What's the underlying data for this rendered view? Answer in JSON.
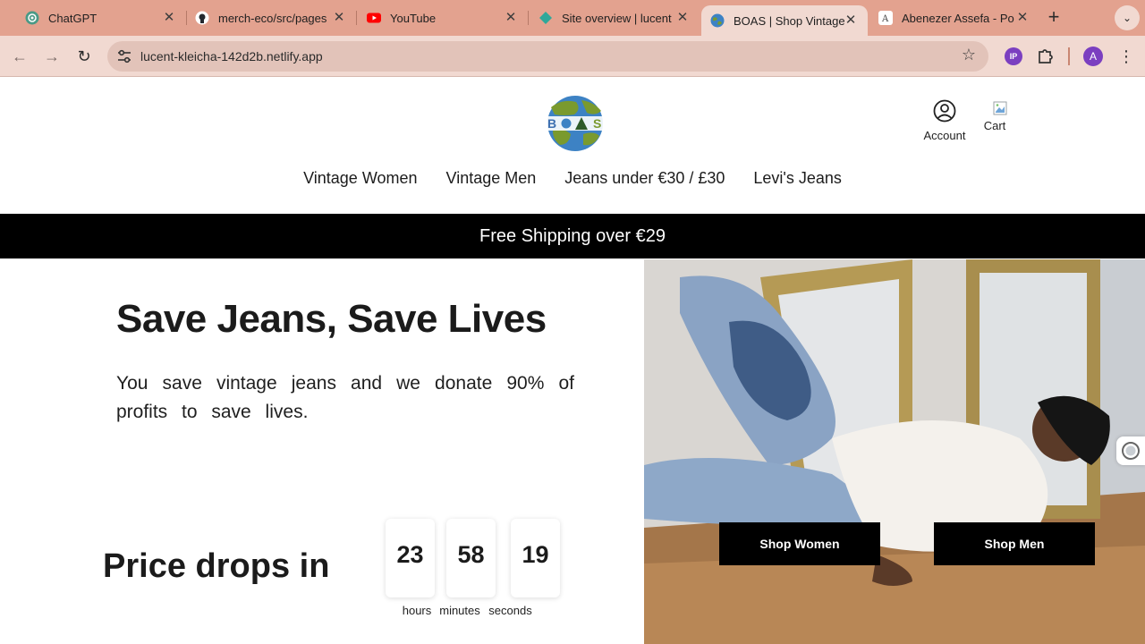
{
  "browser": {
    "tabs": [
      {
        "title": "ChatGPT",
        "icon": "chatgpt-icon"
      },
      {
        "title": "merch-eco/src/pages",
        "icon": "github-icon"
      },
      {
        "title": "YouTube",
        "icon": "youtube-icon"
      },
      {
        "title": "Site overview | lucent",
        "icon": "netlify-icon"
      },
      {
        "title": "BOAS | Shop Vintage",
        "icon": "boas-favicon",
        "active": true
      },
      {
        "title": "Abenezer Assefa - Po",
        "icon": "page-icon"
      }
    ],
    "url": "lucent-kleicha-142d2b.netlify.app",
    "ext_ip_label": "IP",
    "profile_initial": "A"
  },
  "header": {
    "logo_text": "BOAS",
    "account_label": "Account",
    "cart_label": "Cart"
  },
  "nav": [
    "Vintage Women",
    "Vintage Men",
    "Jeans under €30 / £30",
    "Levi's Jeans"
  ],
  "banner": "Free Shipping over €29",
  "hero": {
    "headline": "Save Jeans, Save Lives",
    "subcopy_line1": "You save vintage jeans and we donate 90% of",
    "subcopy_line2": "profits to save lives.",
    "shop_women": "Shop Women",
    "shop_men": "Shop Men"
  },
  "countdown": {
    "title": "Price drops in",
    "hours": "23",
    "minutes": "58",
    "seconds": "19",
    "hours_label": "hours",
    "minutes_label": "minutes",
    "seconds_label": "seconds"
  },
  "colors": {
    "tabbar": "#e3a28f",
    "toolbar": "#f1d9d1",
    "banner": "#000000",
    "logo_globe_blue": "#3d82c4",
    "logo_globe_green": "#7a9a2e"
  }
}
